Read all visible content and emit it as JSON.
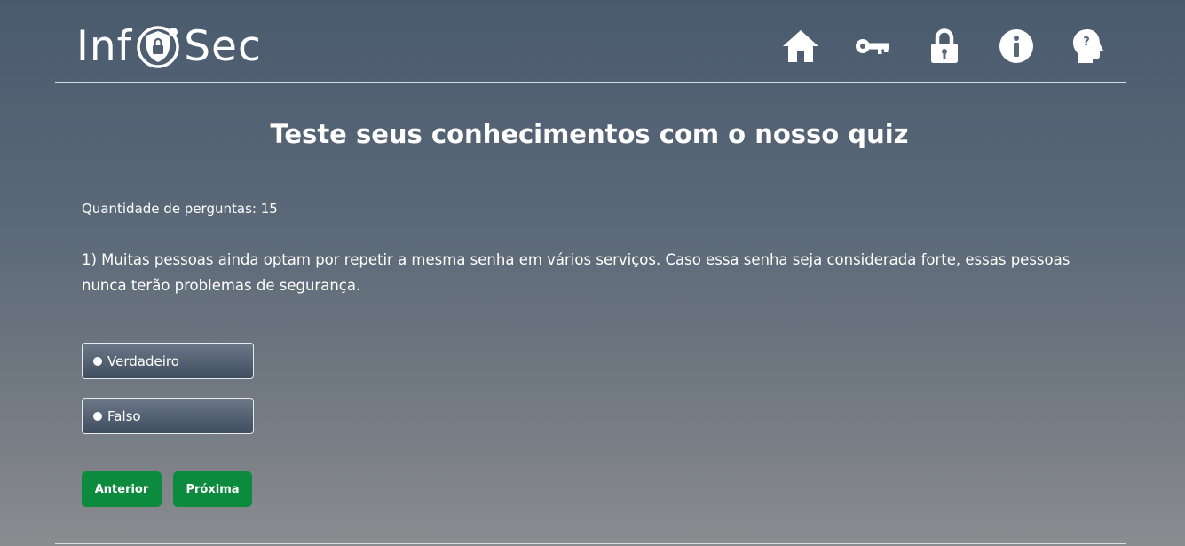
{
  "header": {
    "logo": {
      "text_before": "Inf",
      "text_after": "Sec",
      "emblem_icon": "shield-lock-icon"
    },
    "nav": [
      {
        "icon": "home-icon"
      },
      {
        "icon": "key-icon"
      },
      {
        "icon": "lock-icon"
      },
      {
        "icon": "info-icon"
      },
      {
        "icon": "head-question-icon"
      }
    ]
  },
  "main": {
    "title": "Teste seus conhecimentos com o nosso quiz",
    "question_count_label": "Quantidade de perguntas: 15",
    "question_text": "1) Muitas pessoas ainda optam por repetir a mesma senha em vários serviços. Caso essa senha seja considerada forte, essas pessoas nunca terão problemas de segurança.",
    "options": [
      {
        "label": "Verdadeiro"
      },
      {
        "label": "Falso"
      }
    ],
    "buttons": {
      "previous": "Anterior",
      "next": "Próxima"
    }
  },
  "colors": {
    "accent_button": "#0c8a3e",
    "text": "#ffffff",
    "background_top": "#4a5b6e",
    "background_bottom": "#8a8c8f"
  }
}
